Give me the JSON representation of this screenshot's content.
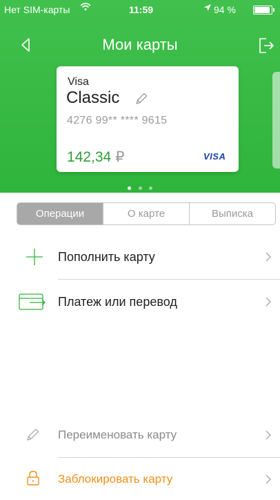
{
  "status_bar": {
    "carrier": "Нет SIM-карты",
    "time": "11:59",
    "battery": "94 %"
  },
  "nav": {
    "title": "Мои карты"
  },
  "card": {
    "brand": "Visa",
    "name": "Classic",
    "number": "4276 99** **** 9615",
    "balance": "142,34",
    "currency": "₽",
    "logo": "VISA"
  },
  "pager": {
    "count": 3,
    "active": 1
  },
  "tabs": [
    {
      "label": "Операции",
      "active": true
    },
    {
      "label": "О карте",
      "active": false
    },
    {
      "label": "Выписка",
      "active": false
    }
  ],
  "actions": [
    {
      "label": "Пополнить карту",
      "icon": "plus-icon"
    },
    {
      "label": "Платеж или перевод",
      "icon": "transfer-card-icon"
    }
  ],
  "bottom_actions": [
    {
      "label": "Переименовать карту",
      "icon": "pencil-icon",
      "color": "#8a8a8a"
    },
    {
      "label": "Заблокировать карту",
      "icon": "lock-icon",
      "color": "#f0901a"
    }
  ],
  "colors": {
    "brand_green": "#2fb43c",
    "balance_green": "#2f9d36",
    "warning_orange": "#f0901a"
  }
}
